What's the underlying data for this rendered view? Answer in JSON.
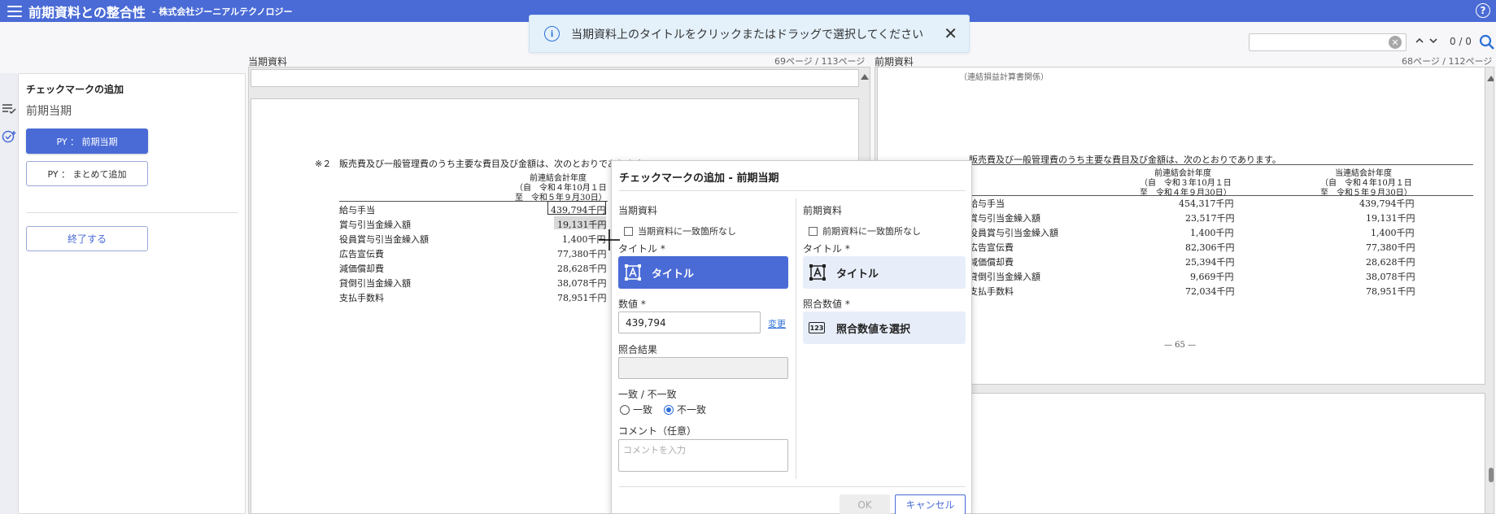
{
  "header": {
    "title": "前期資料との整合性",
    "company": "- 株式会社ジーニアルテクノロジー",
    "help_icon": "question-circle-icon"
  },
  "toast": {
    "message": "当期資料上のタイトルをクリックまたはドラッグで選択してください",
    "close": "✕"
  },
  "search": {
    "value": "",
    "count": "0 / 0"
  },
  "left_panel": {
    "title": "チェックマークの追加",
    "subtitle": "前期当期",
    "py_current_label": "PY ： 前期当期",
    "py_bulk_label": "PY ： まとめて追加",
    "end_label": "終了する"
  },
  "viewer_current": {
    "label": "当期資料",
    "page": "69ページ / 113ページ"
  },
  "viewer_prior": {
    "label": "前期資料",
    "page": "68ページ / 112ページ"
  },
  "doc_current": {
    "note_mark": "※２",
    "heading": "販売費及び一般管理費のうち主要な費目及び金額は、次のとおりであります。",
    "col_header_1": "前連結会計年度",
    "col_header_2": "（自　令和４年10月１日",
    "col_header_3": "至　令和５年９月30日）",
    "rows": [
      {
        "label": "給与手当",
        "value": "439,794千円"
      },
      {
        "label": "賞与引当金繰入額",
        "value": "19,131千円"
      },
      {
        "label": "役員賞与引当金繰入額",
        "value": "1,400千円"
      },
      {
        "label": "広告宣伝費",
        "value": "77,380千円"
      },
      {
        "label": "減価償却費",
        "value": "28,628千円"
      },
      {
        "label": "貸倒引当金繰入額",
        "value": "38,078千円"
      },
      {
        "label": "支払手数料",
        "value": "78,951千円"
      }
    ]
  },
  "doc_prior": {
    "top_fragment": "（連結損益計算書関係）",
    "heading": "販売費及び一般管理費のうち主要な費目及び金額は、次のとおりであります。",
    "col_a_1": "前連結会計年度",
    "col_a_2": "（自　令和３年10月１日",
    "col_a_3": "至　令和４年９月30日）",
    "col_b_1": "当連結会計年度",
    "col_b_2": "（自　令和４年10月１日",
    "col_b_3": "至　令和５年９月30日）",
    "rows": [
      {
        "label": "給与手当",
        "prior": "454,317千円",
        "current": "439,794千円"
      },
      {
        "label": "賞与引当金繰入額",
        "prior": "23,517千円",
        "current": "19,131千円"
      },
      {
        "label": "役員賞与引当金繰入額",
        "prior": "1,400千円",
        "current": "1,400千円"
      },
      {
        "label": "広告宣伝費",
        "prior": "82,306千円",
        "current": "77,380千円"
      },
      {
        "label": "減価償却費",
        "prior": "25,394千円",
        "current": "28,628千円"
      },
      {
        "label": "貸倒引当金繰入額",
        "prior": "9,669千円",
        "current": "38,078千円"
      },
      {
        "label": "支払手数料",
        "prior": "72,034千円",
        "current": "78,951千円"
      }
    ],
    "page_number": "— 65 —"
  },
  "modal": {
    "title": "チェックマークの追加 - 前期当期",
    "current_section": "当期資料",
    "prior_section": "前期資料",
    "no_match_current": "当期資料に一致箇所なし",
    "no_match_prior": "前期資料に一致箇所なし",
    "title_label": "タイトル *",
    "title_button": "タイトル",
    "value_label": "数値 *",
    "value": "439,794",
    "change_link": "変更",
    "match_value_label": "照合数値 *",
    "match_value_button": "照合数値を選択",
    "match_result_label": "照合結果",
    "match_result_value": "",
    "consistency_label": "一致 / 不一致",
    "match_option": "一致",
    "mismatch_option": "不一致",
    "comment_label": "コメント（任意）",
    "comment_placeholder": "コメントを入力",
    "ok_label": "OK",
    "cancel_label": "キャンセル"
  }
}
